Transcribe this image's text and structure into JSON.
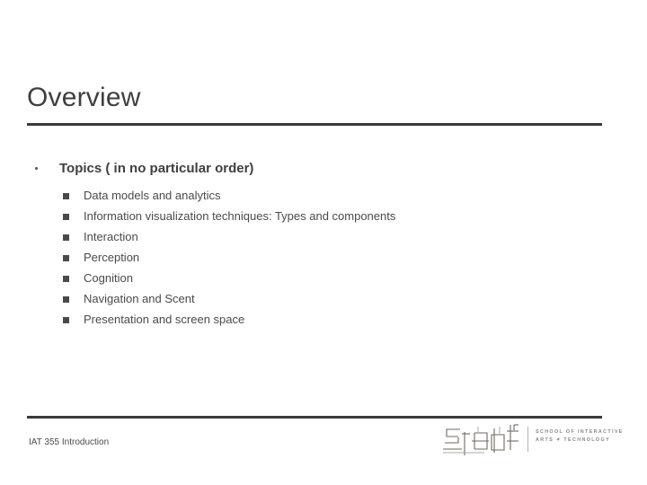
{
  "slide": {
    "title": "Overview",
    "bullet_icon": "dot-bullet-icon",
    "sub_bullet_icon": "square-bullet-icon",
    "topics_heading": "Topics ( in no particular order)",
    "topics": [
      "Data models and analytics",
      "Information visualization techniques: Types and components",
      "Interaction",
      "Perception",
      "Cognition",
      "Navigation and Scent",
      "Presentation and screen space"
    ]
  },
  "footer": {
    "course_label": "IAT 355 Introduction",
    "logo": {
      "mark_name": "siat-logo-mark",
      "line1": "SCHOOL OF INTERACTIVE",
      "line2_pre": "ARTS ",
      "line2_symbol": "✦",
      "line2_post": " TECHNOLOGY"
    }
  },
  "colors": {
    "rule": "#3a3a3c",
    "title_text": "#3f3f42",
    "body_text": "#4a4a4d",
    "logo_text": "#8d8880",
    "background": "#ffffff"
  }
}
